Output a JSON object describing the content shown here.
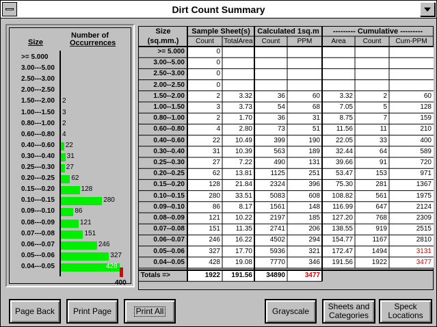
{
  "window": {
    "title": "Dirt Count Summary"
  },
  "histogram": {
    "size_header": "Size",
    "count_header_line1": "Number of",
    "count_header_line2": "Occurrences",
    "axis_max_label": "400",
    "axis_max_value": 400,
    "rows": [
      {
        "size": ">=  5.000",
        "count": ""
      },
      {
        "size": "3.00---5.00",
        "count": ""
      },
      {
        "size": "2.50---3.00",
        "count": ""
      },
      {
        "size": "2.00---2.50",
        "count": ""
      },
      {
        "size": "1.50---2.00",
        "count": "2"
      },
      {
        "size": "1.00---1.50",
        "count": "3"
      },
      {
        "size": "0.80---1.00",
        "count": "2"
      },
      {
        "size": "0.60---0.80",
        "count": "4"
      },
      {
        "size": "0.40---0.60",
        "count": "22"
      },
      {
        "size": "0.30---0.40",
        "count": "31"
      },
      {
        "size": "0.25---0.30",
        "count": "27"
      },
      {
        "size": "0.20---0.25",
        "count": "62"
      },
      {
        "size": "0.15---0.20",
        "count": "128"
      },
      {
        "size": "0.10---0.15",
        "count": "280"
      },
      {
        "size": "0.09---0.10",
        "count": "86"
      },
      {
        "size": "0.08---0.09",
        "count": "121"
      },
      {
        "size": "0.07---0.08",
        "count": "151"
      },
      {
        "size": "0.06---0.07",
        "count": "246"
      },
      {
        "size": "0.05---0.06",
        "count": "327"
      },
      {
        "size": "0.04---0.05",
        "count": "428"
      }
    ],
    "overflow_color": "#e00000",
    "bar_color": "#00ee00"
  },
  "table": {
    "headers": {
      "size": "Size",
      "size_unit": "(sq.mm.)",
      "sample": "Sample Sheet(s)",
      "calc": "Calculated 1sq.m",
      "cumulative": "--------- Cumulative ---------"
    },
    "subheaders": [
      "Count",
      "TotalArea",
      "Count",
      "PPM",
      "Area",
      "Count",
      "Cum-PPM"
    ],
    "rows": [
      {
        "size": ">=  5.000",
        "count": "0",
        "area": "",
        "ccount": "",
        "ppm": "",
        "carea": "",
        "cucount": "",
        "cppm": ""
      },
      {
        "size": "3.00--5.00",
        "count": "0",
        "area": "",
        "ccount": "",
        "ppm": "",
        "carea": "",
        "cucount": "",
        "cppm": ""
      },
      {
        "size": "2.50--3.00",
        "count": "0",
        "area": "",
        "ccount": "",
        "ppm": "",
        "carea": "",
        "cucount": "",
        "cppm": ""
      },
      {
        "size": "2.00--2.50",
        "count": "0",
        "area": "",
        "ccount": "",
        "ppm": "",
        "carea": "",
        "cucount": "",
        "cppm": ""
      },
      {
        "size": "1.50--2.00",
        "count": "2",
        "area": "3.32",
        "ccount": "36",
        "ppm": "60",
        "carea": "3.32",
        "cucount": "2",
        "cppm": "60"
      },
      {
        "size": "1.00--1.50",
        "count": "3",
        "area": "3.73",
        "ccount": "54",
        "ppm": "68",
        "carea": "7.05",
        "cucount": "5",
        "cppm": "128"
      },
      {
        "size": "0.80--1.00",
        "count": "2",
        "area": "1.70",
        "ccount": "36",
        "ppm": "31",
        "carea": "8.75",
        "cucount": "7",
        "cppm": "159"
      },
      {
        "size": "0.60--0.80",
        "count": "4",
        "area": "2.80",
        "ccount": "73",
        "ppm": "51",
        "carea": "11.56",
        "cucount": "11",
        "cppm": "210"
      },
      {
        "size": "0.40--0.60",
        "count": "22",
        "area": "10.49",
        "ccount": "399",
        "ppm": "190",
        "carea": "22.05",
        "cucount": "33",
        "cppm": "400"
      },
      {
        "size": "0.30--0.40",
        "count": "31",
        "area": "10.39",
        "ccount": "563",
        "ppm": "189",
        "carea": "32.44",
        "cucount": "64",
        "cppm": "589"
      },
      {
        "size": "0.25--0.30",
        "count": "27",
        "area": "7.22",
        "ccount": "490",
        "ppm": "131",
        "carea": "39.66",
        "cucount": "91",
        "cppm": "720"
      },
      {
        "size": "0.20--0.25",
        "count": "62",
        "area": "13.81",
        "ccount": "1125",
        "ppm": "251",
        "carea": "53.47",
        "cucount": "153",
        "cppm": "971"
      },
      {
        "size": "0.15--0.20",
        "count": "128",
        "area": "21.84",
        "ccount": "2324",
        "ppm": "396",
        "carea": "75.30",
        "cucount": "281",
        "cppm": "1367"
      },
      {
        "size": "0.10--0.15",
        "count": "280",
        "area": "33.51",
        "ccount": "5083",
        "ppm": "608",
        "carea": "108.82",
        "cucount": "561",
        "cppm": "1975"
      },
      {
        "size": "0.09--0.10",
        "count": "86",
        "area": "8.17",
        "ccount": "1561",
        "ppm": "148",
        "carea": "116.99",
        "cucount": "647",
        "cppm": "2124"
      },
      {
        "size": "0.08--0.09",
        "count": "121",
        "area": "10.22",
        "ccount": "2197",
        "ppm": "185",
        "carea": "127.20",
        "cucount": "768",
        "cppm": "2309"
      },
      {
        "size": "0.07--0.08",
        "count": "151",
        "area": "11.35",
        "ccount": "2741",
        "ppm": "206",
        "carea": "138.55",
        "cucount": "919",
        "cppm": "2515"
      },
      {
        "size": "0.06--0.07",
        "count": "246",
        "area": "16.22",
        "ccount": "4502",
        "ppm": "294",
        "carea": "154.77",
        "cucount": "1167",
        "cppm": "2810"
      },
      {
        "size": "0.05--0.06",
        "count": "327",
        "area": "17.70",
        "ccount": "5936",
        "ppm": "321",
        "carea": "172.47",
        "cucount": "1494",
        "cppm": "3131",
        "cppm_red": true
      },
      {
        "size": "0.04--0.05",
        "count": "428",
        "area": "19.08",
        "ccount": "7770",
        "ppm": "346",
        "carea": "191.56",
        "cucount": "1922",
        "cppm": "3477",
        "cppm_red": true
      }
    ],
    "totals": {
      "label": "Totals =>",
      "count": "1922",
      "area": "191.56",
      "ccount": "34890",
      "ppm": "3477"
    },
    "highlight_color": "#e00000"
  },
  "buttons": {
    "page_back": "Page Back",
    "print_page": "Print Page",
    "print_all": "Print All",
    "grayscale": "Grayscale",
    "sheets_categories_1": "Sheets and",
    "sheets_categories_2": "Categories",
    "speck_locations_1": "Speck",
    "speck_locations_2": "Locations"
  }
}
